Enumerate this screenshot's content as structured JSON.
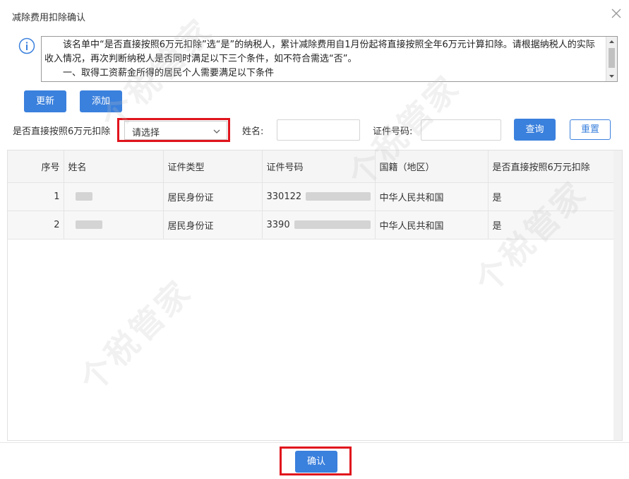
{
  "dialog": {
    "title": "减除费用扣除确认",
    "close_icon": "close-icon"
  },
  "notice": {
    "icon": "info-icon",
    "lines": [
      "该名单中“是否直接按照6万元扣除”选“是”的纳税人，累计减除费用自1月份起将直接按照全年6万元计算扣除。请根据纳税人的实际收入情况，再次判断纳税人是否同时满足以下三个条件，如不符合需选“否”。",
      "一、取得工资薪金所得的居民个人需要满足以下条件"
    ]
  },
  "toolbar": {
    "update_label": "更新",
    "add_label": "添加"
  },
  "filters": {
    "deduct_label": "是否直接按照6万元扣除",
    "deduct_value": "请选择",
    "name_label": "姓名:",
    "name_value": "",
    "id_label": "证件号码:",
    "id_value": "",
    "query_label": "查询",
    "reset_label": "重置"
  },
  "table": {
    "columns": [
      "序号",
      "姓名",
      "证件类型",
      "证件号码",
      "国籍（地区）",
      "是否直接按照6万元扣除"
    ],
    "rows": [
      {
        "index": "1",
        "name": "",
        "id_type": "居民身份证",
        "id_number": "330122",
        "nationality": "中华人民共和国",
        "deduct": "是"
      },
      {
        "index": "2",
        "name": "",
        "id_type": "居民身份证",
        "id_number": "3390",
        "nationality": "中华人民共和国",
        "deduct": "是"
      }
    ]
  },
  "footer": {
    "confirm_label": "确认"
  },
  "watermark": {
    "text": "个税管家"
  },
  "colors": {
    "primary": "#3a80dd",
    "highlight": "#e0141c"
  }
}
